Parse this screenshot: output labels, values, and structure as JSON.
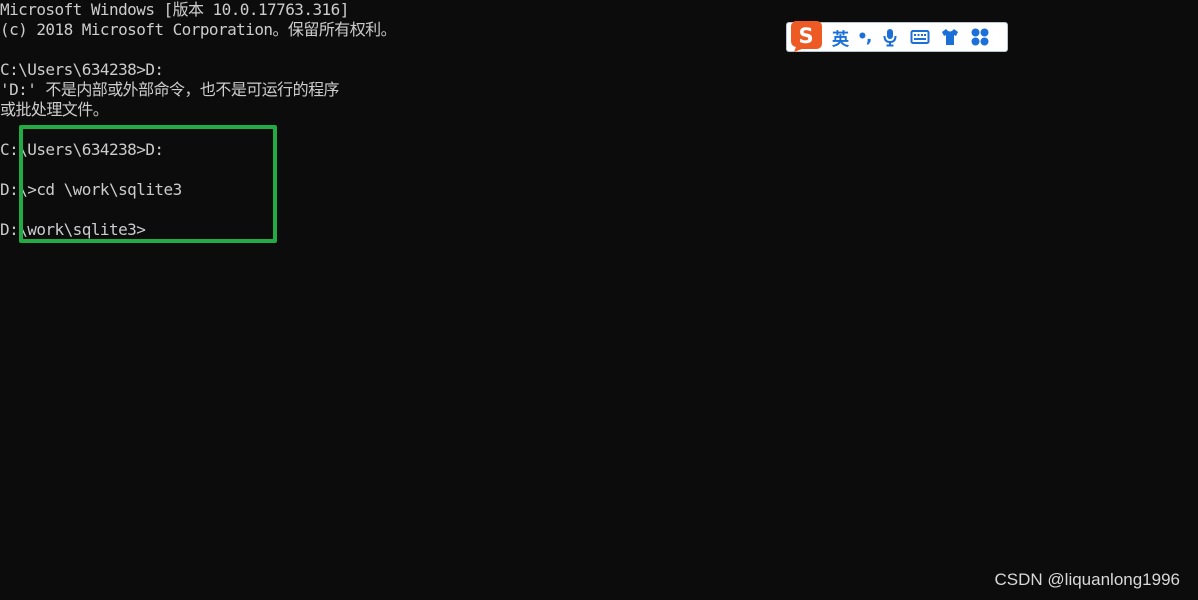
{
  "console": {
    "lines": [
      "Microsoft Windows [版本 10.0.17763.316]",
      "(c) 2018 Microsoft Corporation。保留所有权利。",
      "",
      "C:\\Users\\634238>D:",
      "'D:' 不是内部或外部命令，也不是可运行的程序",
      "或批处理文件。",
      "",
      "C:\\Users\\634238>D:",
      "",
      "D:\\>cd \\work\\sqlite3",
      "",
      "D:\\work\\sqlite3>"
    ]
  },
  "ime_toolbar": {
    "logo_letter": "S",
    "mode_label": "英",
    "punct_label": "•,",
    "icons": [
      "microphone-icon",
      "keyboard-icon",
      "skin-shirt-icon",
      "toolbox-grid-icon"
    ],
    "accent_color": "#1a6fd8",
    "logo_color": "#ee5a24"
  },
  "highlight": {
    "color": "#22aa44"
  },
  "watermark": {
    "text": "CSDN @liquanlong1996"
  }
}
